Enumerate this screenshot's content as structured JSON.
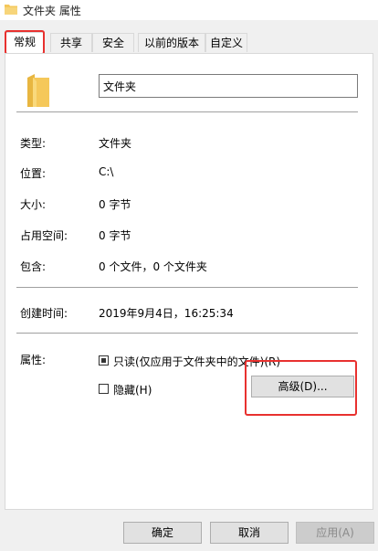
{
  "window": {
    "title": "文件夹 属性"
  },
  "tabs": [
    {
      "label": "常规"
    },
    {
      "label": "共享"
    },
    {
      "label": "安全"
    },
    {
      "label": "以前的版本"
    },
    {
      "label": "自定义"
    }
  ],
  "general": {
    "name_value": "文件夹",
    "type": {
      "label": "类型:",
      "value": "文件夹"
    },
    "location": {
      "label": "位置:",
      "value": "C:\\"
    },
    "size": {
      "label": "大小:",
      "value": "0 字节"
    },
    "size_on_disk": {
      "label": "占用空间:",
      "value": "0 字节"
    },
    "contains": {
      "label": "包含:",
      "value": "0 个文件，0 个文件夹"
    },
    "created": {
      "label": "创建时间:",
      "value": "2019年9月4日，16:25:34"
    },
    "attributes": {
      "label": "属性:",
      "readonly_label": "只读(仅应用于文件夹中的文件)(R)",
      "readonly_state": "indeterminate",
      "hidden_label": "隐藏(H)",
      "hidden_checked": false,
      "advanced_button": "高级(D)..."
    }
  },
  "footer": {
    "ok": "确定",
    "cancel": "取消",
    "apply": "应用(A)",
    "apply_disabled": true
  },
  "icons": {
    "title_icon": "folder-icon",
    "large_icon": "folder-icon"
  },
  "colors": {
    "highlight": "#e8312f",
    "folder": "#f5c85a"
  }
}
